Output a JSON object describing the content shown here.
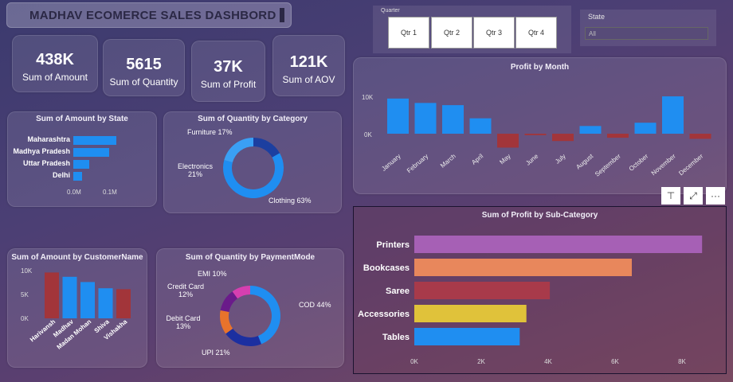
{
  "dashboard": {
    "title": "MADHAV ECOMERCE SALES DASHBORD"
  },
  "kpis": [
    {
      "value": "438K",
      "label": "Sum of Amount"
    },
    {
      "value": "5615",
      "label": "Sum of Quantity"
    },
    {
      "value": "37K",
      "label": "Sum of Profit"
    },
    {
      "value": "121K",
      "label": "Sum of AOV"
    }
  ],
  "quarter_slicer": {
    "caption": "Quarter",
    "options": [
      "Qtr 1",
      "Qtr 2",
      "Qtr 3",
      "Qtr 4"
    ]
  },
  "state_slicer": {
    "caption": "State",
    "selected": "All"
  },
  "visual_header": {
    "icons": [
      "filter-icon",
      "focus-mode-icon",
      "more-options-icon"
    ],
    "filter_glyph": "⊤",
    "focus_glyph": "⤢",
    "more_glyph": "···"
  },
  "colors": {
    "blue": "#1f8ef1",
    "red": "#a2353a",
    "purple": "#a660b5",
    "orange": "#e8875c",
    "maroon": "#a83a4a",
    "yellow": "#e0c23a"
  },
  "chart_data": [
    {
      "id": "amount-by-state",
      "type": "bar",
      "orientation": "horizontal",
      "title": "Sum of Amount by State",
      "categories": [
        "Maharashtra",
        "Madhya Pradesh",
        "Uttar Pradesh",
        "Delhi"
      ],
      "values": [
        0.12,
        0.1,
        0.045,
        0.025
      ],
      "xlim": [
        0,
        0.15
      ],
      "x_ticks": [
        "0.0M",
        "0.1M"
      ]
    },
    {
      "id": "quantity-by-category",
      "type": "pie",
      "title": "Sum of Quantity by Category",
      "categories": [
        "Clothing",
        "Electronics",
        "Furniture"
      ],
      "values": [
        63,
        21,
        17
      ],
      "labels": [
        "Clothing 63%",
        "Electronics 21%",
        "Furniture 17%"
      ]
    },
    {
      "id": "profit-by-month",
      "type": "bar",
      "title": "Profit by Month",
      "categories": [
        "January",
        "February",
        "March",
        "April",
        "May",
        "June",
        "July",
        "August",
        "September",
        "October",
        "November",
        "December"
      ],
      "values": [
        9600,
        8400,
        7800,
        4200,
        -3800,
        -400,
        -2000,
        2100,
        -1100,
        3000,
        10200,
        -1400
      ],
      "ylim": [
        -5000,
        12000
      ],
      "y_ticks": [
        "10K",
        "0K"
      ]
    },
    {
      "id": "profit-by-subcategory",
      "type": "bar",
      "orientation": "horizontal",
      "title": "Sum of Profit by Sub-Category",
      "categories": [
        "Printers",
        "Bookcases",
        "Saree",
        "Accessories",
        "Tables"
      ],
      "values": [
        8600,
        6500,
        4050,
        3350,
        3150
      ],
      "xlim": [
        0,
        9000
      ],
      "x_ticks": [
        "0K",
        "2K",
        "4K",
        "6K",
        "8K"
      ]
    },
    {
      "id": "amount-by-customer",
      "type": "bar",
      "title": "Sum of Amount by CustomerName",
      "categories": [
        "Harivansh",
        "Madhav",
        "Madan Mohan",
        "Shiva",
        "Vishakha"
      ],
      "values": [
        9600,
        8700,
        7600,
        6300,
        6100
      ],
      "ylim": [
        0,
        10000
      ],
      "y_ticks": [
        "10K",
        "5K",
        "0K"
      ]
    },
    {
      "id": "quantity-by-paymentmode",
      "type": "pie",
      "title": "Sum of Quantity by PaymentMode",
      "categories": [
        "COD",
        "UPI",
        "Debit Card",
        "Credit Card",
        "EMI"
      ],
      "values": [
        44,
        21,
        13,
        12,
        10
      ],
      "labels": [
        "COD 44%",
        "UPI 21%",
        "Debit Card 13%",
        "Credit Card 12%",
        "EMI 10%"
      ]
    }
  ]
}
